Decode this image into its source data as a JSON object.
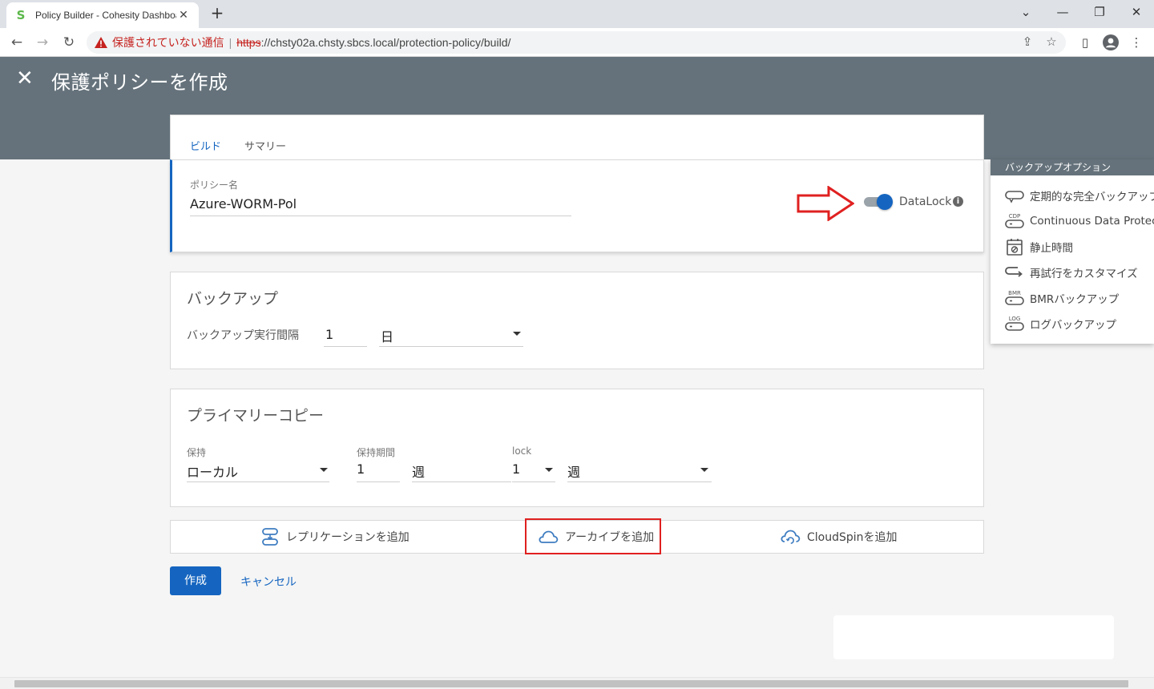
{
  "browser": {
    "tab_title": "Policy Builder - Cohesity Dashboard",
    "tab_favicon": "S",
    "new_tab": "+",
    "security_text": "保護されていない通信",
    "url_scheme": "https",
    "url_rest": "://chsty02a.chsty.sbcs.local/protection-policy/build/"
  },
  "header": {
    "close": "✕",
    "title": "保護ポリシーを作成"
  },
  "tabs": [
    {
      "label": "ビルド",
      "active": true
    },
    {
      "label": "サマリー",
      "active": false
    }
  ],
  "policy": {
    "name_label": "ポリシー名",
    "name_value": "Azure-WORM-Pol",
    "datalock_label": "DataLock",
    "datalock_on": true,
    "info_glyph": "i"
  },
  "backup": {
    "title": "バックアップ",
    "interval_label": "バックアップ実行間隔",
    "interval_value": "1",
    "interval_unit": "日"
  },
  "primary_copy": {
    "title": "プライマリーコピー",
    "retain_label": "保持",
    "retain_value": "ローカル",
    "period_label": "保持期間",
    "period_value": "1",
    "period_unit": "週",
    "lock_label": "lock",
    "lock_value": "1",
    "lock_unit": "週"
  },
  "actions": {
    "replication": "レプリケーションを追加",
    "archive": "アーカイブを追加",
    "cloudspin": "CloudSpinを追加"
  },
  "buttons": {
    "create": "作成",
    "cancel": "キャンセル"
  },
  "side_panel": {
    "title": "バックアップオプション",
    "items": [
      {
        "label": "定期的な完全バックアップ",
        "icon": "full-backup-icon"
      },
      {
        "label": "Continuous Data Protection",
        "icon": "cdp-icon"
      },
      {
        "label": "静止時間",
        "icon": "blackout-calendar-icon"
      },
      {
        "label": "再試行をカスタマイズ",
        "icon": "retry-icon"
      },
      {
        "label": "BMRバックアップ",
        "icon": "bmr-icon"
      },
      {
        "label": "ログバックアップ",
        "icon": "log-icon"
      }
    ],
    "badges": {
      "cdp": "CDP",
      "bmr": "BMR",
      "log": "LOG"
    }
  },
  "colors": {
    "header": "#65727b",
    "primary": "#1565c0",
    "annotation_red": "#e02020"
  }
}
